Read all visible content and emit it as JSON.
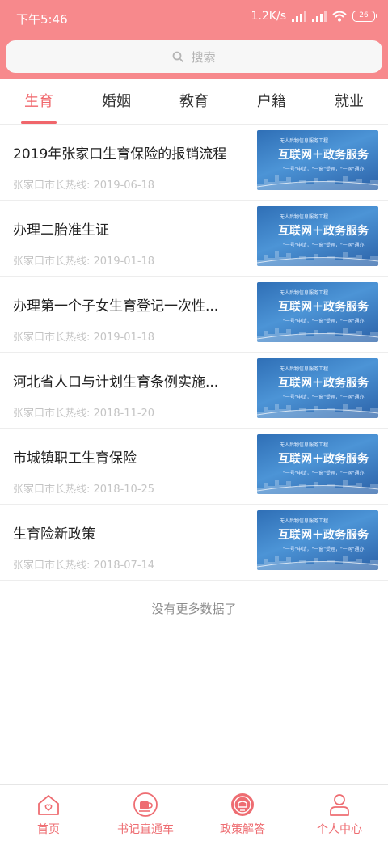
{
  "status_bar": {
    "time": "下午5:46",
    "speed": "1.2K/s",
    "battery": "26"
  },
  "search": {
    "placeholder": "搜索"
  },
  "tabs": [
    {
      "label": "生育",
      "active": true
    },
    {
      "label": "婚姻",
      "active": false
    },
    {
      "label": "教育",
      "active": false
    },
    {
      "label": "户籍",
      "active": false
    },
    {
      "label": "就业",
      "active": false
    }
  ],
  "thumbnail": {
    "small_text": "无人后物信息服务工程",
    "title": "互联网＋政务服务",
    "subtitle": "\"一号\"申请，\"一窗\"受理，\"一网\"通办"
  },
  "items": [
    {
      "title": "2019年张家口生育保险的报销流程",
      "meta": "张家口市长热线: 2019-06-18"
    },
    {
      "title": "办理二胎准生证",
      "meta": "张家口市长热线: 2019-01-18"
    },
    {
      "title": "办理第一个子女生育登记一次性...",
      "meta": "张家口市长热线: 2019-01-18"
    },
    {
      "title": "河北省人口与计划生育条例实施...",
      "meta": "张家口市长热线: 2018-11-20"
    },
    {
      "title": "市城镇职工生育保险",
      "meta": "张家口市长热线: 2018-10-25"
    },
    {
      "title": "生育险新政策",
      "meta": "张家口市长热线: 2018-07-14"
    }
  ],
  "list_end_text": "没有更多数据了",
  "bottom_nav": [
    {
      "label": "首页",
      "icon": "home-heart-icon"
    },
    {
      "label": "书记直通车",
      "icon": "cup-icon"
    },
    {
      "label": "政策解答",
      "icon": "qa-badge-icon"
    },
    {
      "label": "个人中心",
      "icon": "person-icon"
    }
  ],
  "colors": {
    "header": "#f7898c",
    "accent": "#f0666b",
    "thumbnail_blue": "#2f6fb6"
  }
}
